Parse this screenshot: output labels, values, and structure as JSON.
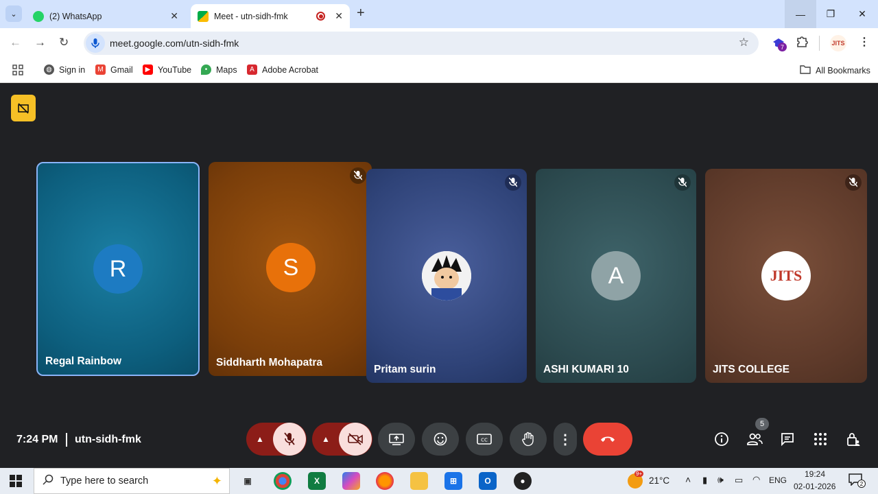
{
  "browser": {
    "tabs": [
      {
        "title": "(2) WhatsApp",
        "active": false
      },
      {
        "title": "Meet - utn-sidh-fmk",
        "active": true
      }
    ],
    "url": "meet.google.com/utn-sidh-fmk",
    "extension_badge": "7",
    "bookmarks": [
      {
        "label": "Sign in"
      },
      {
        "label": "Gmail"
      },
      {
        "label": "YouTube"
      },
      {
        "label": "Maps"
      },
      {
        "label": "Adobe Acrobat"
      }
    ],
    "all_bookmarks": "All Bookmarks"
  },
  "meet": {
    "participants": [
      {
        "name": "Regal Rainbow",
        "initial": "R",
        "color": "#1d7bc2",
        "muted": false,
        "speaking": true
      },
      {
        "name": "Siddharth Mohapatra",
        "initial": "S",
        "color": "#e8710a",
        "muted": true
      },
      {
        "name": "Pritam surin",
        "initial": "",
        "muted": true,
        "avatar": "character-photo"
      },
      {
        "name": "ASHI KUMARI 10",
        "initial": "A",
        "color": "#8fa3a6",
        "muted": true
      },
      {
        "name": "JITS COLLEGE",
        "initial": "JITS",
        "muted": true,
        "avatar": "college-logo"
      }
    ],
    "time": "7:24 PM",
    "meeting_code": "utn-sidh-fmk",
    "people_count": "5",
    "controls": [
      "mic-off",
      "camera-off",
      "present",
      "reactions",
      "captions",
      "raise-hand",
      "more-options",
      "leave-call"
    ],
    "right_controls": [
      "meeting-info",
      "people",
      "chat",
      "activities",
      "host-controls"
    ]
  },
  "taskbar": {
    "search_placeholder": "Type here to search",
    "weather": "21°C",
    "weather_badge": "9+",
    "language": "ENG",
    "time": "19:24",
    "date": "02-01-2026",
    "notification_count": "2",
    "apps": [
      "task-view",
      "chrome",
      "excel",
      "copilot",
      "firefox",
      "file-explorer",
      "microsoft-store",
      "outlook",
      "obs"
    ]
  },
  "colors": {
    "meet_bg": "#202124",
    "leave_red": "#ea4335",
    "mute_red": "#8c1d18",
    "tab_strip": "#d3e3fd"
  }
}
